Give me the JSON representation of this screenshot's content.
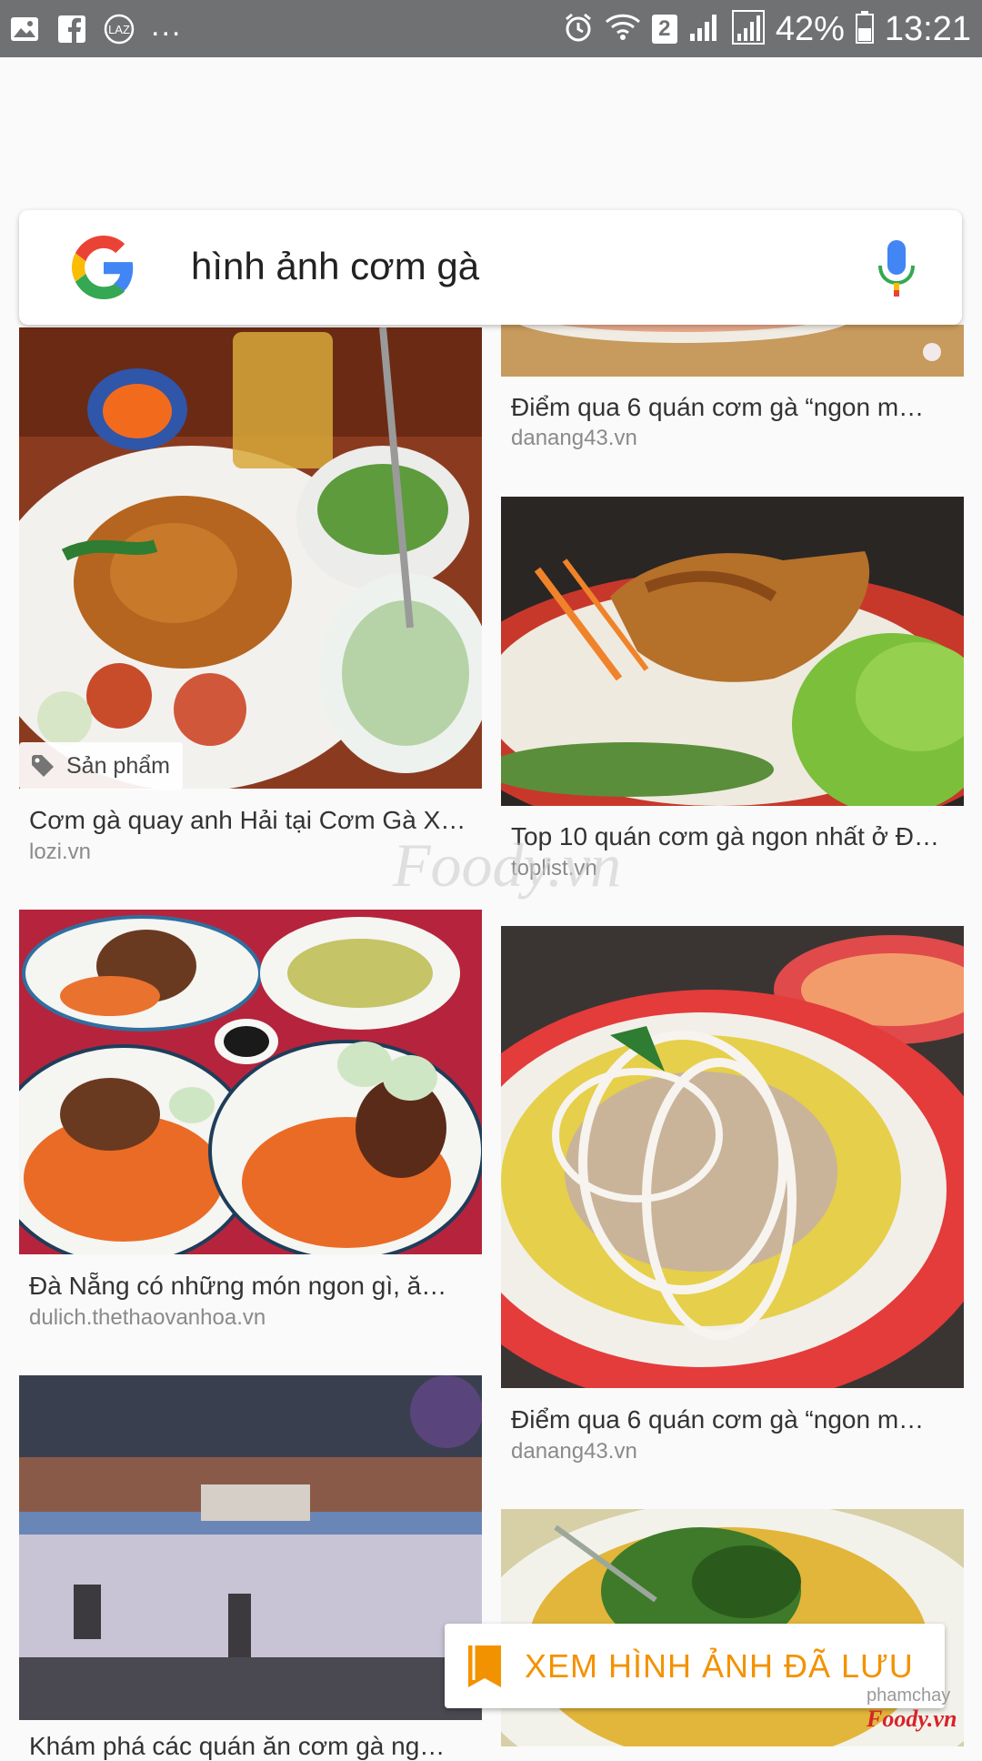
{
  "status_bar": {
    "left_icons": [
      "image-icon",
      "facebook-icon",
      "lazada-icon"
    ],
    "overflow": "...",
    "sim_badge": "2",
    "battery": "42%",
    "time": "13:21"
  },
  "search": {
    "query": "hình ảnh cơm gà"
  },
  "results": [
    {
      "title": "Điểm qua 6 quán cơm gà “ngon m…",
      "source": "danang43.vn",
      "watermark": "Foody"
    },
    {
      "title": "Cơm gà quay anh Hải tại Cơm Gà X…",
      "source": "lozi.vn",
      "tag": "Sản phẩm"
    },
    {
      "title": "Top 10 quán cơm gà ngon nhất ở Đ…",
      "source": "toplist.vn"
    },
    {
      "title": "Đà Nẵng có những món ngon gì, ă…",
      "source": "dulich.thethaovanhoa.vn"
    },
    {
      "title": "Điểm qua 6 quán cơm gà “ngon m…",
      "source": "danang43.vn"
    },
    {
      "title": "Khám phá các quán ăn cơm gà ng…",
      "source": ""
    }
  ],
  "overlay_watermark": "Foody.vn",
  "saved_button": {
    "label": "XEM HÌNH ẢNH ĐÃ LƯU"
  },
  "credit": {
    "user": "phamchay",
    "brand": "Foody.vn"
  },
  "colors": {
    "status_bar": "#6f7173",
    "accent_orange": "#f39200",
    "google_blue": "#4285f4",
    "google_red": "#ea4335",
    "google_yellow": "#fbbc05",
    "google_green": "#34a853"
  }
}
